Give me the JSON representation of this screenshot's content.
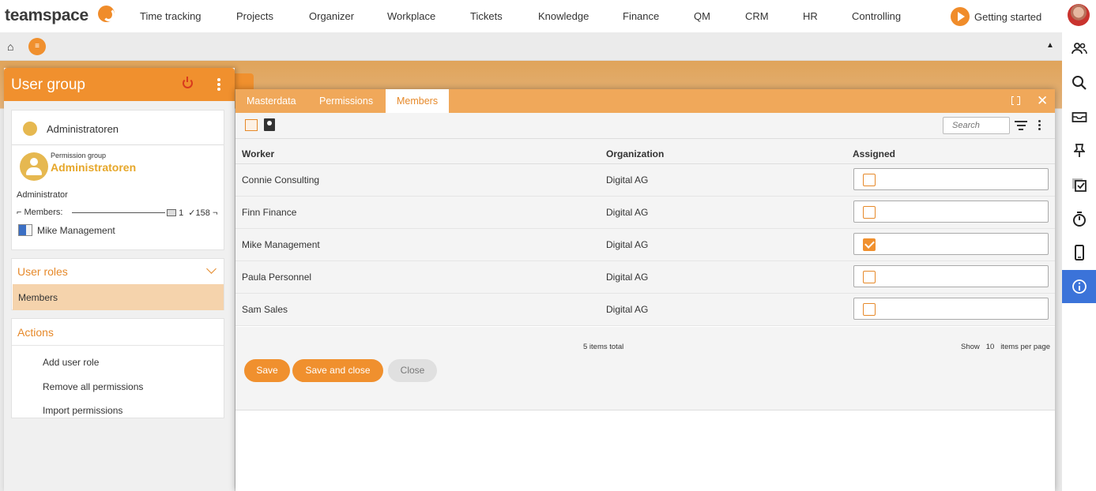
{
  "brand": {
    "logo_text": "teamspace",
    "accent": "#f0902e"
  },
  "nav": {
    "items": [
      "Time tracking",
      "Projects",
      "Organizer",
      "Workplace",
      "Tickets",
      "Knowledge",
      "Finance",
      "QM",
      "CRM",
      "HR",
      "Controlling"
    ],
    "getting_started": "Getting started"
  },
  "subbar": {
    "home_icon": "⌂",
    "menu_icon": "≡",
    "collapse_icon": "▲"
  },
  "left_panel": {
    "title": "User group",
    "group": {
      "name_top": "Administratoren",
      "permission_label": "Permission group",
      "permission_name": "Administratoren",
      "role": "Administrator",
      "members_label": "Members:",
      "members_count": "1",
      "members_check_count": "158",
      "member_name": "Mike Management"
    },
    "user_roles": {
      "title": "User roles",
      "item": "Members"
    },
    "actions": {
      "title": "Actions",
      "items": [
        "Add user role",
        "Remove all permissions",
        "Import permissions"
      ]
    }
  },
  "dialog": {
    "tabs": [
      "Masterdata",
      "Permissions",
      "Members"
    ],
    "active_tab": "Members",
    "search_placeholder": "Search",
    "columns": {
      "worker": "Worker",
      "organization": "Organization",
      "assigned": "Assigned"
    },
    "rows": [
      {
        "worker": "Connie Consulting",
        "organization": "Digital AG",
        "assigned": false
      },
      {
        "worker": "Finn Finance",
        "organization": "Digital AG",
        "assigned": false
      },
      {
        "worker": "Mike Management",
        "organization": "Digital AG",
        "assigned": true
      },
      {
        "worker": "Paula Personnel",
        "organization": "Digital AG",
        "assigned": false
      },
      {
        "worker": "Sam Sales",
        "organization": "Digital AG",
        "assigned": false
      }
    ],
    "items_total": "5 items total",
    "per_page": {
      "show": "Show",
      "count": "10",
      "suffix": "items per page"
    },
    "buttons": {
      "save": "Save",
      "save_close": "Save and close",
      "close": "Close"
    }
  },
  "rail_icons": [
    "users-icon",
    "search-icon",
    "inbox-icon",
    "pin-icon",
    "tasks-icon",
    "stopwatch-icon",
    "mobile-icon",
    "info-icon"
  ]
}
